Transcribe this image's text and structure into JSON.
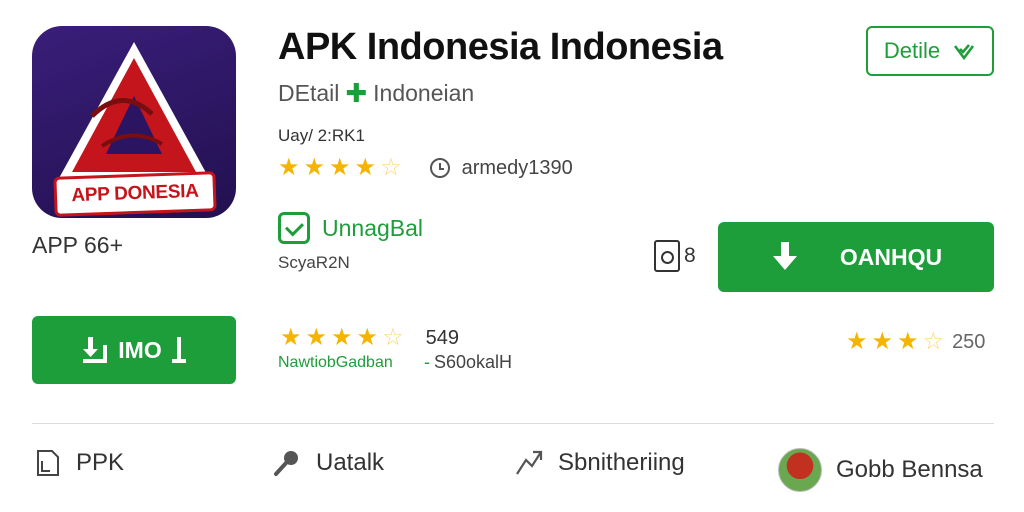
{
  "app": {
    "icon_text": "APP DONESIA",
    "title": "APK Indonesia Indonesia",
    "subtitle_left": "DEtail",
    "subtitle_right": "Indoneian",
    "age_rating": "APP 66+",
    "day_line": "Uay/ 2:RK1",
    "author": "armedy1390",
    "verified_label": "UnnagBal",
    "store_label": "ScyaR2N",
    "copy_count": "8"
  },
  "buttons": {
    "detile_label": "Detile",
    "download_label": "OANHQU",
    "install_label": "IMO"
  },
  "ratings": {
    "primary": {
      "value": 4.5,
      "author_icon": "clock-icon"
    },
    "secondary": {
      "value": 4.5,
      "count": "549",
      "link": "NawtiobGadban",
      "note": "S60okalH"
    },
    "tertiary": {
      "value": 3.5,
      "count": "250"
    }
  },
  "footer": {
    "items": [
      {
        "label": "PPK",
        "icon": "document-icon"
      },
      {
        "label": "Uatalk",
        "icon": "microphone-icon"
      },
      {
        "label": "Sbnitheriing",
        "icon": "share-icon"
      },
      {
        "label": "Gobb Bennsa",
        "icon": "avatar"
      }
    ]
  },
  "colors": {
    "accent_green": "#1e9e3a",
    "star_yellow": "#f5b400",
    "icon_bg": "#2b1562",
    "icon_red": "#c4151c"
  }
}
